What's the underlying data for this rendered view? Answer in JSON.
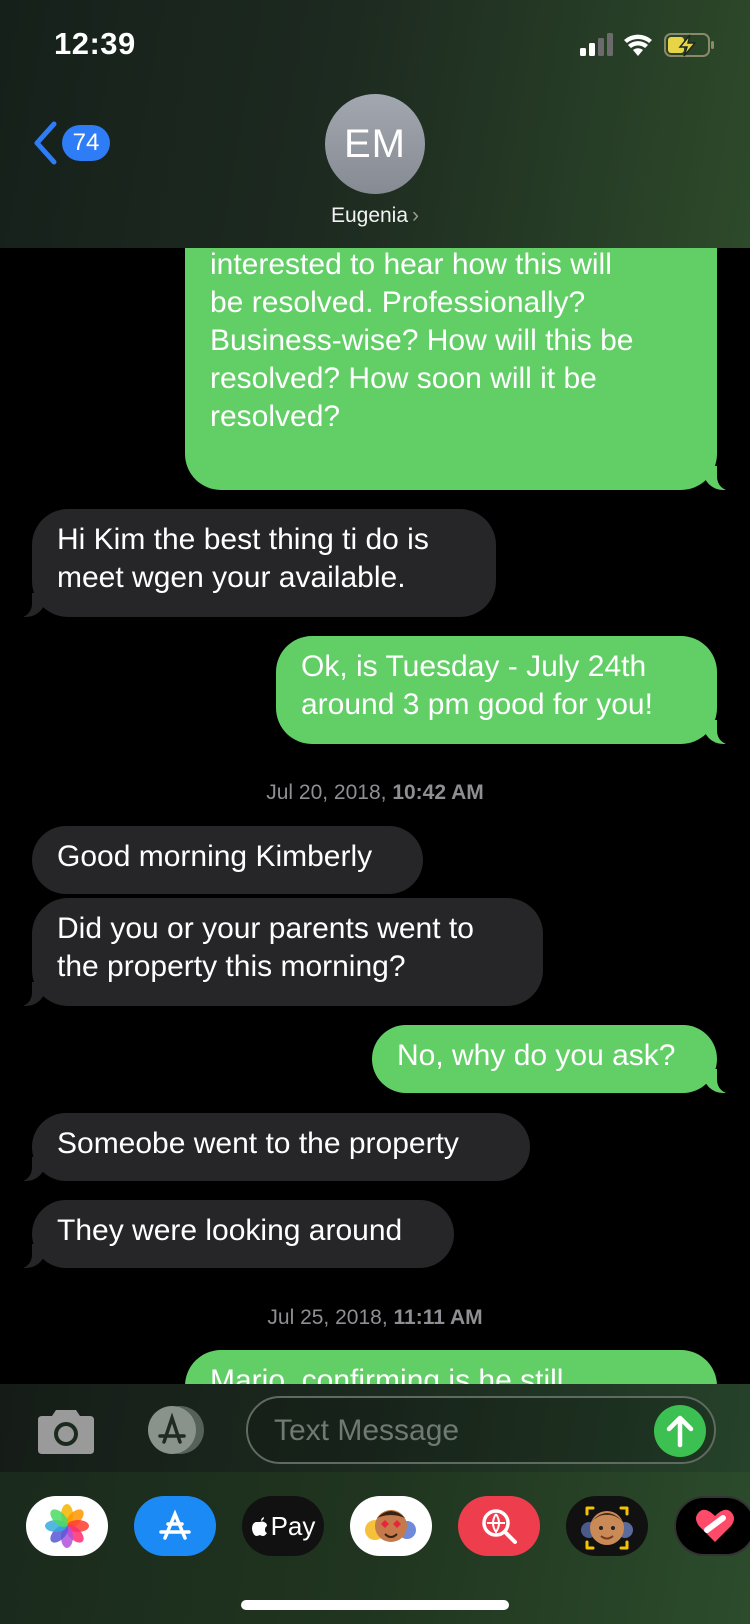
{
  "status_bar": {
    "time": "12:39"
  },
  "header": {
    "back_count": "74",
    "avatar_initials": "EM",
    "contact_name": "Eugenia",
    "chevron": "›"
  },
  "messages": [
    {
      "direction": "outgoing",
      "lines": [
        "interested to hear how this will",
        "be resolved. Professionally?",
        "Business-wise? How will this be",
        "resolved? How soon will it be",
        "resolved?"
      ]
    },
    {
      "direction": "incoming",
      "lines": [
        "Hi Kim the best thing ti do is",
        "meet wgen your available."
      ]
    },
    {
      "direction": "outgoing",
      "lines": [
        "Ok, is Tuesday - July 24th",
        "around 3 pm good for you!"
      ]
    },
    {
      "type": "timestamp",
      "date": "Jul 20, 2018,",
      "time": "10:42 AM"
    },
    {
      "direction": "incoming",
      "lines": [
        "Good morning Kimberly"
      ]
    },
    {
      "direction": "incoming",
      "lines": [
        "Did you or your parents went to",
        "the property this morning?"
      ]
    },
    {
      "direction": "outgoing",
      "lines": [
        "No, why do you ask?"
      ]
    },
    {
      "direction": "incoming",
      "lines": [
        "Someobe went to the property"
      ]
    },
    {
      "direction": "incoming",
      "lines": [
        "They were looking around"
      ]
    },
    {
      "type": "timestamp",
      "date": "Jul 25, 2018,",
      "time": "11:11 AM"
    },
    {
      "direction": "outgoing",
      "lines": [
        "Mario, confirming is he still"
      ]
    }
  ],
  "input": {
    "placeholder": "Text Message"
  },
  "app_drawer": {
    "items": [
      {
        "icon": "photos-icon",
        "bg": "#ffffff"
      },
      {
        "icon": "app-store-icon",
        "bg": "#1c8af5"
      },
      {
        "icon": "apple-pay-icon",
        "bg": "#111111",
        "label": "Pay"
      },
      {
        "icon": "animoji-icon",
        "bg": "#ffffff"
      },
      {
        "icon": "web-search-icon",
        "bg": "#ee3e4e"
      },
      {
        "icon": "memoji-icon",
        "bg": "#111111"
      },
      {
        "icon": "digital-touch-icon",
        "bg": "#000000"
      }
    ]
  },
  "colors": {
    "outgoing_bubble": "#62cf66",
    "incoming_bubble": "#262628",
    "badge_blue": "#2f7df6",
    "send_green": "#3dc052"
  }
}
